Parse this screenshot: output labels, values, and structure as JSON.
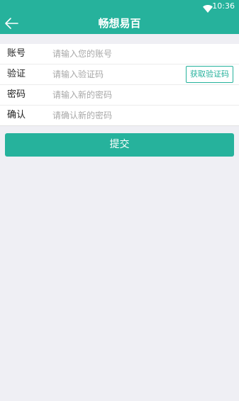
{
  "status_bar": {
    "time": "10:36",
    "wifi_icon": "wifi-icon"
  },
  "header": {
    "title": "畅想易百",
    "back_icon": "arrow-left-icon"
  },
  "form": {
    "account": {
      "label": "账号",
      "placeholder": "请输入您的账号",
      "value": ""
    },
    "verify": {
      "label": "验证",
      "placeholder": "请输入验证码",
      "value": "",
      "button_label": "获取验证码"
    },
    "password": {
      "label": "密码",
      "placeholder": "请输入新的密码",
      "value": ""
    },
    "confirm": {
      "label": "确认",
      "placeholder": "请确认新的密码",
      "value": ""
    }
  },
  "submit": {
    "label": "提交"
  },
  "colors": {
    "accent": "#26b29c",
    "background": "#efeff4",
    "surface": "#ffffff",
    "placeholder": "#a8a8a8"
  }
}
